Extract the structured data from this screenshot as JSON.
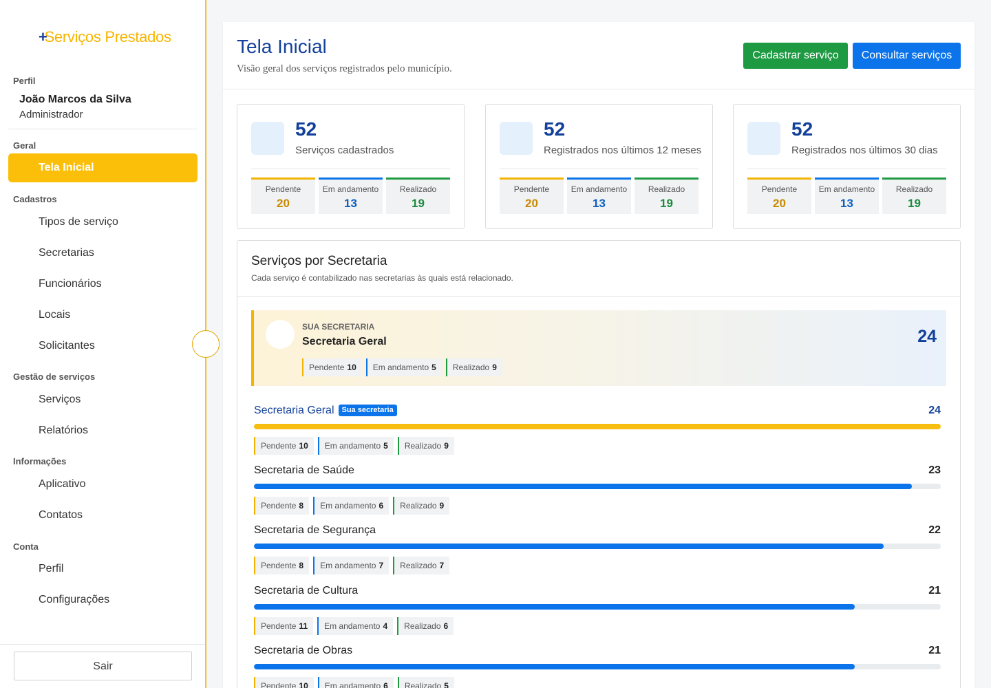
{
  "brand": {
    "plus": "+",
    "name": "Serviços Prestados"
  },
  "profile": {
    "section": "Perfil",
    "name": "João Marcos da Silva",
    "role": "Administrador"
  },
  "nav": {
    "geral": "Geral",
    "tela_inicial": "Tela Inicial",
    "cadastros": "Cadastros",
    "tipos": "Tipos de serviço",
    "secretarias": "Secretarias",
    "funcionarios": "Funcionários",
    "locais": "Locais",
    "solicitantes": "Solicitantes",
    "gestao": "Gestão de serviços",
    "servicos": "Serviços",
    "relatorios": "Relatórios",
    "informacoes": "Informações",
    "aplicativo": "Aplicativo",
    "contatos": "Contatos",
    "conta": "Conta",
    "perfil": "Perfil",
    "config": "Configurações"
  },
  "logout": "Sair",
  "header": {
    "title": "Tela Inicial",
    "subtitle": "Visão geral dos serviços registrados pelo município.",
    "btn_cadastrar": "Cadastrar serviço",
    "btn_consultar": "Consultar serviços"
  },
  "status_labels": {
    "pendente": "Pendente",
    "andamento": "Em andamento",
    "realizado": "Realizado"
  },
  "stats": [
    {
      "value": "52",
      "label": "Serviços cadastrados",
      "pendente": "20",
      "andamento": "13",
      "realizado": "19"
    },
    {
      "value": "52",
      "label": "Registrados nos últimos 12 meses",
      "pendente": "20",
      "andamento": "13",
      "realizado": "19"
    },
    {
      "value": "52",
      "label": "Registrados nos últimos 30 dias",
      "pendente": "20",
      "andamento": "13",
      "realizado": "19"
    }
  ],
  "secretarias_panel": {
    "title": "Serviços por Secretaria",
    "subtitle": "Cada serviço é contabilizado nas secretarias às quais está relacionado.",
    "highlight": {
      "kicker": "SUA SECRETARIA",
      "name": "Secretaria Geral",
      "total": "24",
      "pendente": "10",
      "andamento": "5",
      "realizado": "9"
    },
    "badge": "Sua secretaria",
    "max": 24,
    "rows": [
      {
        "name": "Secretaria Geral",
        "total": 24,
        "pendente": "10",
        "andamento": "5",
        "realizado": "9",
        "color": "#f7be0f"
      },
      {
        "name": "Secretaria de Saúde",
        "total": 23,
        "pendente": "8",
        "andamento": "6",
        "realizado": "9",
        "color": "#0b74ea"
      },
      {
        "name": "Secretaria de Segurança",
        "total": 22,
        "pendente": "8",
        "andamento": "7",
        "realizado": "7",
        "color": "#0b74ea"
      },
      {
        "name": "Secretaria de Cultura",
        "total": 21,
        "pendente": "11",
        "andamento": "4",
        "realizado": "6",
        "color": "#0b74ea"
      },
      {
        "name": "Secretaria de Obras",
        "total": 21,
        "pendente": "10",
        "andamento": "6",
        "realizado": "5",
        "color": "#0b74ea"
      }
    ]
  }
}
